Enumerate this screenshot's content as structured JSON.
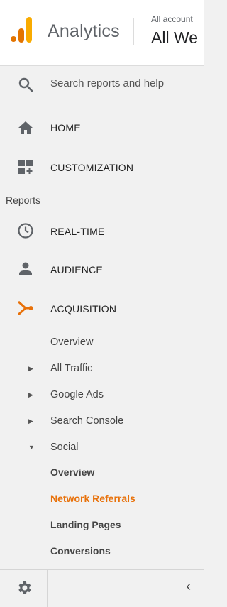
{
  "header": {
    "app_name": "Analytics",
    "account_small": "All account",
    "account_big": "All We",
    "logo_colors": [
      "#f9ab00",
      "#e37400"
    ]
  },
  "search": {
    "placeholder": "Search reports and help",
    "icon": "search-icon"
  },
  "nav": {
    "home": "HOME",
    "customization": "CUSTOMIZATION",
    "reports_heading": "Reports",
    "realtime": "REAL-TIME",
    "audience": "AUDIENCE",
    "acquisition": "ACQUISITION",
    "acquisition_sub": {
      "overview": "Overview",
      "all_traffic": "All Traffic",
      "google_ads": "Google Ads",
      "search_console": "Search Console",
      "social": "Social"
    },
    "social_sub": {
      "overview": "Overview",
      "network_referrals": "Network Referrals",
      "landing_pages": "Landing Pages",
      "conversions": "Conversions"
    }
  },
  "footer": {
    "collapse_glyph": "‹",
    "settings_icon": "gear-icon"
  },
  "colors": {
    "accent": "#e8710a",
    "icon_gray": "#5f6368"
  }
}
